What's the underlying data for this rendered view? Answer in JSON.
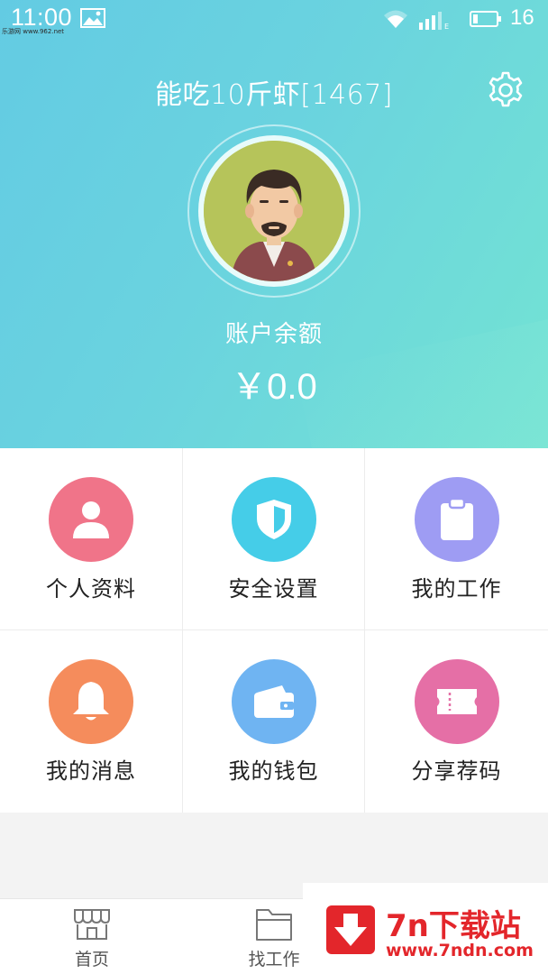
{
  "status_bar": {
    "time": "11:00",
    "battery": "16",
    "watermark": "乐游网 www.962.net",
    "icons": [
      "image-icon",
      "wifi-icon",
      "signal-icon",
      "battery-icon"
    ]
  },
  "header": {
    "username": "能吃10斤虾[1467]",
    "balance_label": "账户余额",
    "balance_value": "￥0.0",
    "settings_icon": "gear-icon",
    "gradient_colors": [
      "#63cbe3",
      "#73e3d3"
    ]
  },
  "grid": {
    "items": [
      {
        "label": "个人资料",
        "icon": "person-icon",
        "color": "#f07489"
      },
      {
        "label": "安全设置",
        "icon": "shield-icon",
        "color": "#45cde8"
      },
      {
        "label": "我的工作",
        "icon": "clipboard-icon",
        "color": "#9e9cf3"
      },
      {
        "label": "我的消息",
        "icon": "bell-icon",
        "color": "#f58c5c"
      },
      {
        "label": "我的钱包",
        "icon": "wallet-icon",
        "color": "#6fb4f2"
      },
      {
        "label": "分享荐码",
        "icon": "ticket-icon",
        "color": "#e56fa6"
      }
    ]
  },
  "bottom_nav": {
    "items": [
      {
        "label": "首页",
        "icon": "storefront-icon"
      },
      {
        "label": "找工作",
        "icon": "folder-icon"
      }
    ]
  },
  "watermark_banner": {
    "title": "7n下载站",
    "url": "www.7ndn.com",
    "color": "#e3262b"
  }
}
